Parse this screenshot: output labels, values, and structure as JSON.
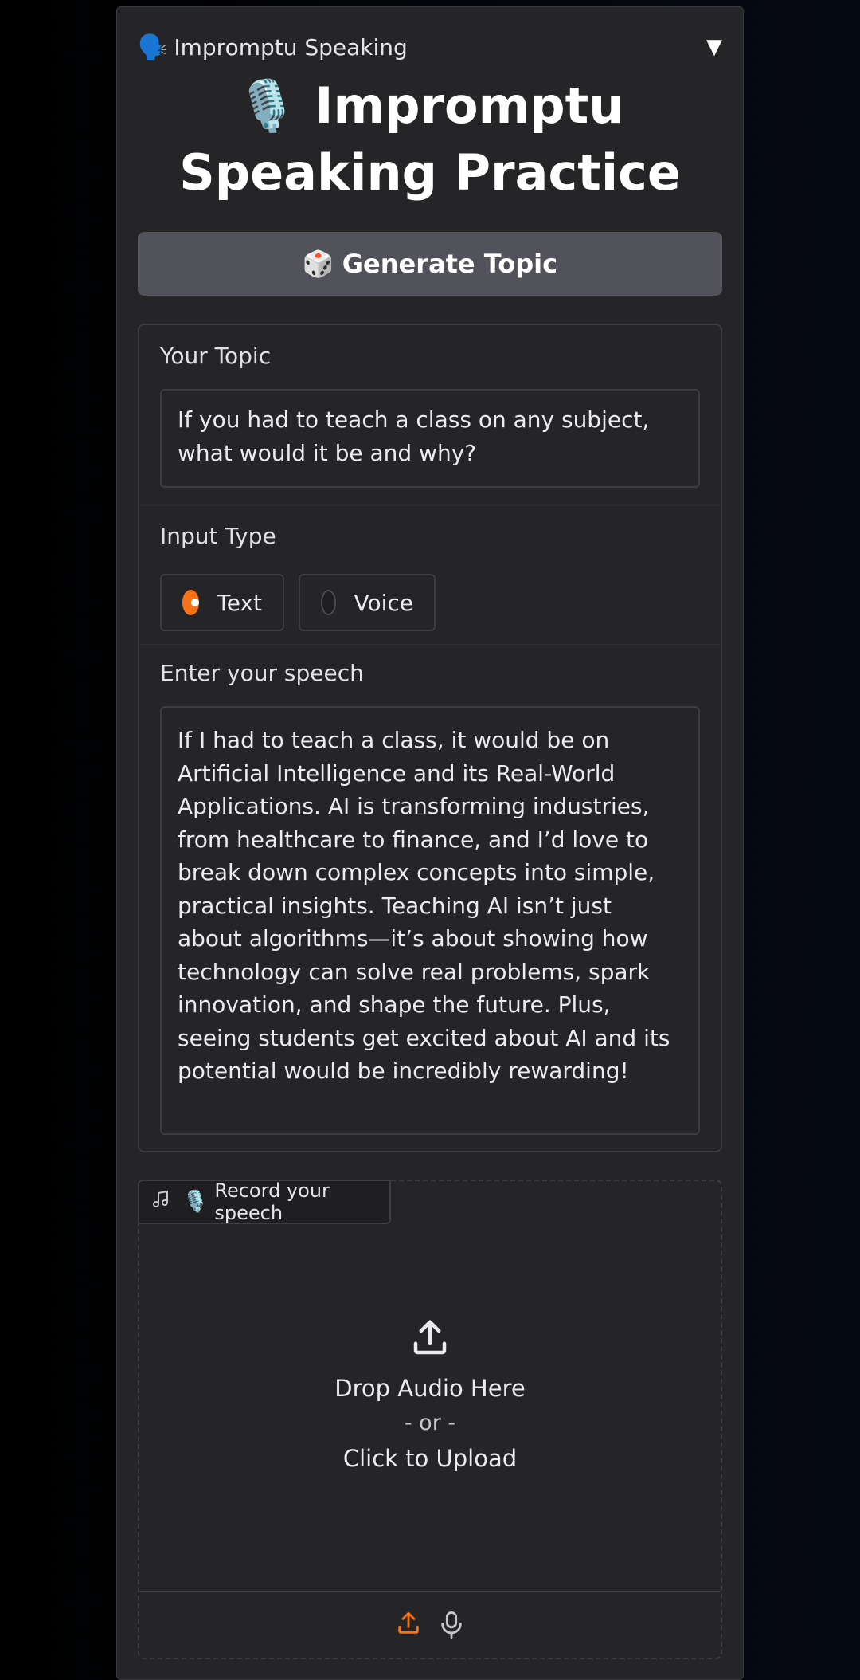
{
  "accordion": {
    "icon": "🗣️",
    "title": "Impromptu Speaking",
    "caret": "▼"
  },
  "title": {
    "icon": "🎙️",
    "text": "Impromptu Speaking Practice"
  },
  "generate_button": {
    "icon": "🎲",
    "label": "Generate Topic"
  },
  "topic": {
    "label": "Your Topic",
    "value": "If you had to teach a class on any subject, what would it be and why?"
  },
  "input_type": {
    "label": "Input Type",
    "options": [
      {
        "label": "Text",
        "selected": true
      },
      {
        "label": "Voice",
        "selected": false
      }
    ]
  },
  "speech": {
    "label": "Enter your speech",
    "value": "If I had to teach a class, it would be on Artificial Intelligence and its Real-World Applications. AI is transforming industries, from healthcare to finance, and I’d love to break down complex concepts into simple, practical insights. Teaching AI isn’t just about algorithms—it’s about showing how technology can solve real problems, spark innovation, and shape the future. Plus, seeing students get excited about AI and its potential would be incredibly rewarding!"
  },
  "audio": {
    "tab_icon": "🎙️",
    "tab_label": "Record your speech",
    "drop_text": "Drop Audio Here",
    "or_text": "- or -",
    "click_text": "Click to Upload",
    "icons": [
      "music-note-icon",
      "upload-icon",
      "microphone-icon"
    ]
  },
  "colors": {
    "accent": "#f97316",
    "card": "#252528",
    "button": "#52525a"
  }
}
